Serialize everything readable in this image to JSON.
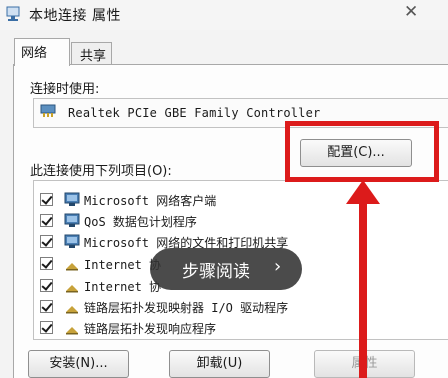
{
  "window": {
    "title": "本地连接 属性",
    "close_glyph": "✕"
  },
  "tabs": [
    {
      "label": "网络",
      "active": true
    },
    {
      "label": "共享",
      "active": false
    }
  ],
  "connect_using": {
    "label": "连接时使用:",
    "adapter": "Realtek PCIe GBE Family Controller"
  },
  "configure_button": "配置(C)...",
  "items_section": {
    "label": "此连接使用下列项目(O):",
    "items": [
      {
        "label": "Microsoft 网络客户端",
        "checked": true,
        "icon": "network-client-icon"
      },
      {
        "label": "QoS 数据包计划程序",
        "checked": true,
        "icon": "qos-scheduler-icon"
      },
      {
        "label": "Microsoft 网络的文件和打印机共享",
        "checked": true,
        "icon": "file-printer-sharing-icon"
      },
      {
        "label": "Internet 协",
        "checked": true,
        "icon": "protocol-icon"
      },
      {
        "label": "Internet 协",
        "checked": true,
        "icon": "protocol-icon"
      },
      {
        "label": "链路层拓扑发现映射器 I/O 驱动程序",
        "checked": true,
        "icon": "protocol-icon"
      },
      {
        "label": "链路层拓扑发现响应程序",
        "checked": true,
        "icon": "protocol-icon"
      }
    ]
  },
  "buttons": {
    "install": "安装(N)...",
    "uninstall": "卸载(U)",
    "properties": "属性"
  },
  "overlay": {
    "text": "步骤阅读",
    "chevron": "›"
  },
  "colors": {
    "annotation_red": "#dc1b1b",
    "overlay_bg": "#323232"
  }
}
